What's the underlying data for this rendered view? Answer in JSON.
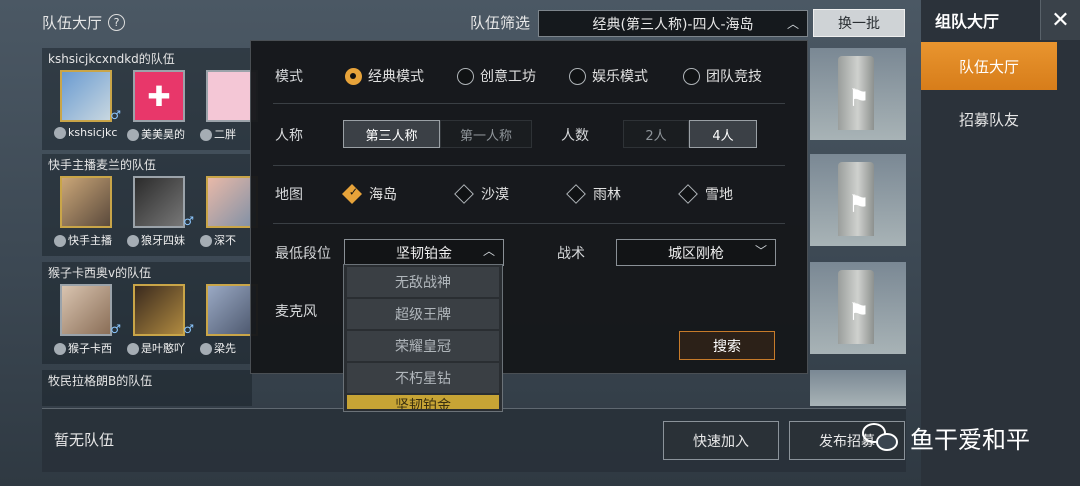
{
  "header": {
    "lobby_title": "队伍大厅",
    "help_icon": "?",
    "filter_label": "队伍筛选",
    "filter_value": "经典(第三人称)-四人-海岛",
    "refresh_button": "换一批"
  },
  "sidebar": {
    "title": "组队大厅",
    "close_icon": "✕",
    "tabs": [
      {
        "label": "队伍大厅",
        "active": true
      },
      {
        "label": "招募队友",
        "active": false
      }
    ]
  },
  "teams": [
    {
      "name": "kshsicjkcxndkd的队伍",
      "members": [
        "kshsicjkc",
        "美美昊的",
        "二胖"
      ]
    },
    {
      "name": "快手主播麦兰的队伍",
      "members": [
        "快手主播",
        "狼牙四妹",
        "深不"
      ]
    },
    {
      "name": "猴子卡西奥v的队伍",
      "members": [
        "猴子卡西",
        "是叶憨吖",
        "梁先"
      ]
    },
    {
      "name": "牧民拉格朗B的队伍",
      "members": []
    }
  ],
  "bottom": {
    "no_team": "暂无队伍",
    "quick_join": "快速加入",
    "publish": "发布招募"
  },
  "watermark": "鱼干爱和平",
  "modal": {
    "mode_label": "模式",
    "modes": [
      {
        "label": "经典模式",
        "selected": true
      },
      {
        "label": "创意工坊",
        "selected": false
      },
      {
        "label": "娱乐模式",
        "selected": false
      },
      {
        "label": "团队竞技",
        "selected": false
      }
    ],
    "perspective_label": "人称",
    "perspectives": [
      {
        "label": "第三人称",
        "selected": true
      },
      {
        "label": "第一人称",
        "selected": false
      }
    ],
    "count_label": "人数",
    "counts": [
      {
        "label": "2人",
        "selected": false
      },
      {
        "label": "4人",
        "selected": true
      }
    ],
    "map_label": "地图",
    "maps": [
      {
        "label": "海岛",
        "selected": true
      },
      {
        "label": "沙漠",
        "selected": false
      },
      {
        "label": "雨林",
        "selected": false
      },
      {
        "label": "雪地",
        "selected": false
      }
    ],
    "min_rank_label": "最低段位",
    "min_rank_value": "坚韧铂金",
    "tactic_label": "战术",
    "tactic_value": "城区刚枪",
    "mic_label": "麦克风",
    "rank_options": [
      "无敌战神",
      "超级王牌",
      "荣耀皇冠",
      "不朽星钻",
      "坚韧铂金"
    ],
    "search_button": "搜索"
  },
  "colors": {
    "accent_orange": "#e7a33a",
    "tab_active": "#e08a25",
    "selected_rank": "#c7a435"
  }
}
